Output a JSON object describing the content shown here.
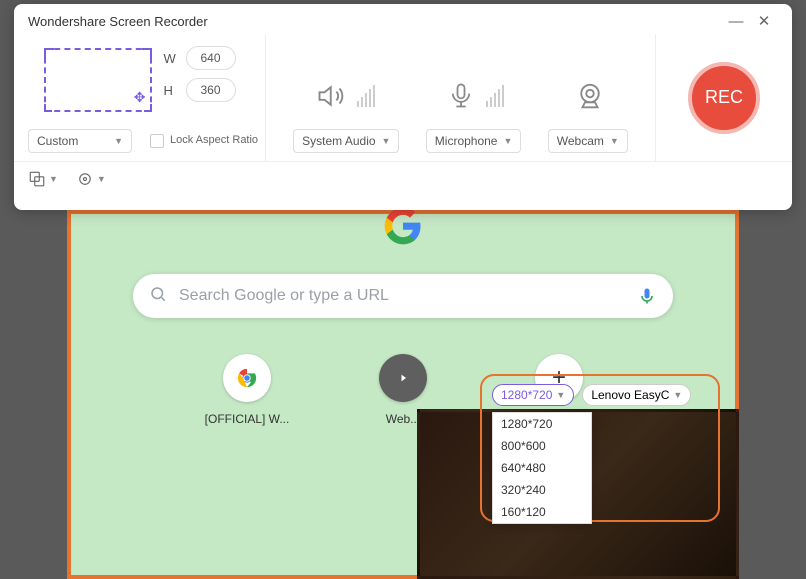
{
  "titlebar": {
    "title": "Wondershare Screen Recorder"
  },
  "capture": {
    "w_label": "W",
    "w_value": "640",
    "h_label": "H",
    "h_value": "360",
    "preset": "Custom",
    "lock_label": "Lock Aspect Ratio"
  },
  "sources": {
    "system_audio": "System Audio",
    "microphone": "Microphone",
    "webcam": "Webcam"
  },
  "rec": {
    "label": "REC"
  },
  "browser": {
    "search_placeholder": "Search Google or type a URL",
    "shortcuts": [
      {
        "label": "[OFFICIAL] W..."
      },
      {
        "label": "Web..."
      },
      {
        "label": ""
      }
    ]
  },
  "webcam_panel": {
    "resolution": "1280*720",
    "camera": "Lenovo EasyC",
    "options": [
      "1280*720",
      "800*600",
      "640*480",
      "320*240",
      "160*120"
    ]
  }
}
